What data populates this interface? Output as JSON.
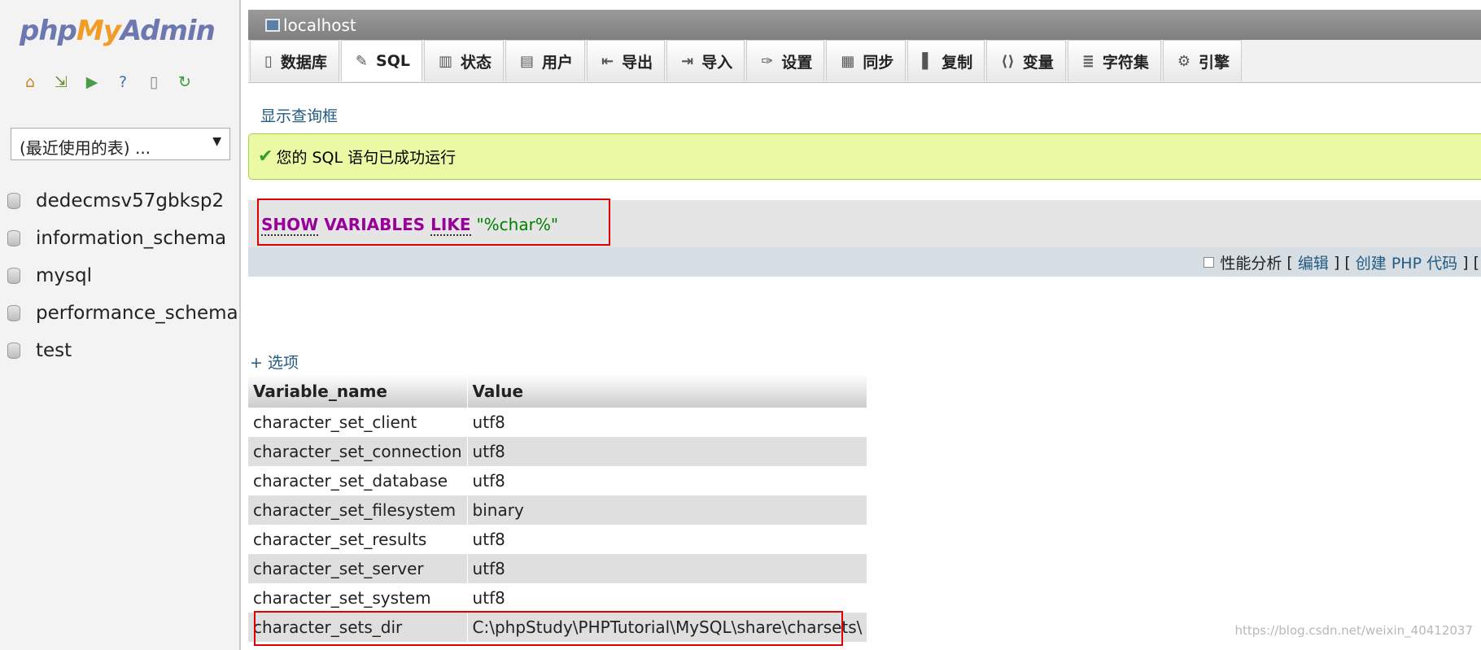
{
  "nav": {
    "logo": {
      "php": "php",
      "my": "My",
      "admin": "Admin"
    },
    "icons": [
      "home-icon",
      "exit-icon",
      "query-window-icon",
      "help-icon",
      "docs-icon",
      "reload-icon"
    ],
    "recent_tables": "(最近使用的表) ...",
    "databases": [
      "dedecmsv57gbksp2",
      "information_schema",
      "mysql",
      "performance_schema",
      "test"
    ]
  },
  "serverbar": {
    "title": "localhost"
  },
  "tabs": [
    {
      "label": "数据库",
      "icon": "database-icon",
      "glyph": "▯"
    },
    {
      "label": "SQL",
      "icon": "sql-icon",
      "glyph": "✎"
    },
    {
      "label": "状态",
      "icon": "status-icon",
      "glyph": "▥"
    },
    {
      "label": "用户",
      "icon": "users-icon",
      "glyph": "▤"
    },
    {
      "label": "导出",
      "icon": "export-icon",
      "glyph": "⇤"
    },
    {
      "label": "导入",
      "icon": "import-icon",
      "glyph": "⇥"
    },
    {
      "label": "设置",
      "icon": "settings-icon",
      "glyph": "✑"
    },
    {
      "label": "同步",
      "icon": "sync-icon",
      "glyph": "▦"
    },
    {
      "label": "复制",
      "icon": "replication-icon",
      "glyph": "▌"
    },
    {
      "label": "变量",
      "icon": "variables-icon",
      "glyph": "⟨⟩"
    },
    {
      "label": "字符集",
      "icon": "charset-icon",
      "glyph": "≣"
    },
    {
      "label": "引擎",
      "icon": "engine-icon",
      "glyph": "⚙"
    }
  ],
  "active_tab": "SQL",
  "show_query_box": "显示查询框",
  "success_message": "您的 SQL 语句已成功运行",
  "sql": {
    "kw1": "SHOW",
    "kw2": "VARIABLES",
    "kw3": "LIKE",
    "string": "\"%char%\""
  },
  "sql_links": {
    "profiling": "性能分析",
    "edit": "编辑",
    "create_php": "创建 PHP 代码"
  },
  "options_label": "+ 选项",
  "table": {
    "headers": [
      "Variable_name",
      "Value"
    ],
    "rows": [
      [
        "character_set_client",
        "utf8"
      ],
      [
        "character_set_connection",
        "utf8"
      ],
      [
        "character_set_database",
        "utf8"
      ],
      [
        "character_set_filesystem",
        "binary"
      ],
      [
        "character_set_results",
        "utf8"
      ],
      [
        "character_set_server",
        "utf8"
      ],
      [
        "character_set_system",
        "utf8"
      ],
      [
        "character_sets_dir",
        "C:\\phpStudy\\PHPTutorial\\MySQL\\share\\charsets\\"
      ]
    ]
  },
  "watermark": "https://blog.csdn.net/weixin_40412037",
  "colors": {
    "link": "#235a81",
    "keyword": "#990099",
    "string": "#008000",
    "highlight": "#e00000",
    "success_bg": "#ebf8a4"
  }
}
